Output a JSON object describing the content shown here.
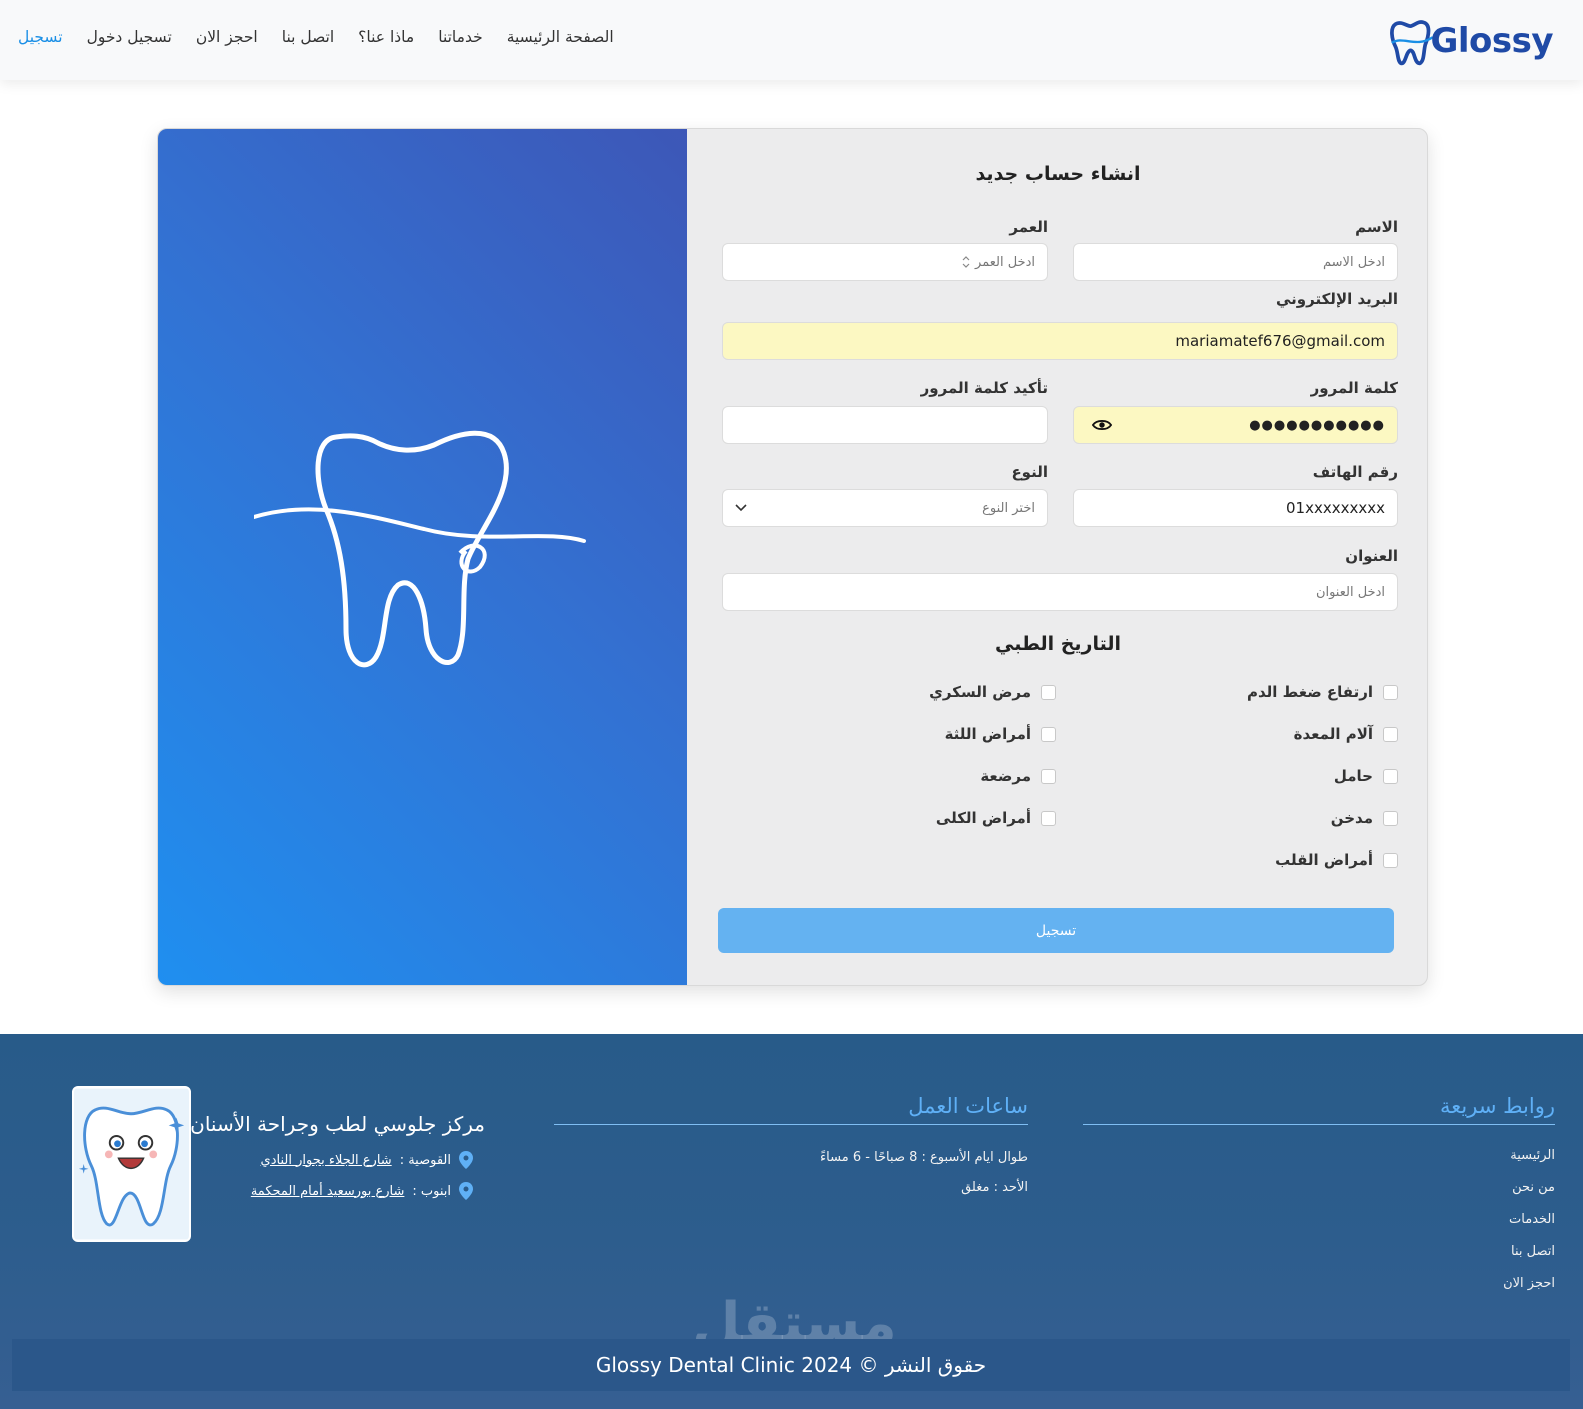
{
  "nav": {
    "logo_text": "Glossy",
    "links": [
      "الصفحة الرئيسية",
      "خدماتنا",
      "ماذا عنا؟",
      "اتصل بنا",
      "احجز الان",
      "تسجيل دخول",
      "تسجيل"
    ],
    "active_index": 6
  },
  "form": {
    "title": "انشاء حساب جديد",
    "name_label": "الاسم",
    "name_placeholder": "ادخل الاسم",
    "age_label": "العمر",
    "age_placeholder": "ادخل العمر",
    "email_label": "البريد الإلكتروني",
    "email_value": "mariamatef676@gmail.com",
    "password_label": "كلمة المرور",
    "password_value": "●●●●●●●●●●●",
    "confirm_label": "تأكيد كلمة المرور",
    "confirm_value": "",
    "phone_label": "رقم الهاتف",
    "phone_value": "01xxxxxxxxx",
    "gender_label": "النوع",
    "gender_selected": "اختر النوع",
    "address_label": "العنوان",
    "address_placeholder": "ادخل العنوان",
    "medical_title": "التاريخ الطبي",
    "conditions_right": [
      "ارتفاع ضغط الدم",
      "آلام المعدة",
      "حامل",
      "مدخن",
      "أمراض القلب"
    ],
    "conditions_left": [
      "مرض السكري",
      "أمراض اللثة",
      "مرضعة",
      "أمراض الكلى"
    ],
    "submit_label": "تسجيل"
  },
  "footer": {
    "quick_links_title": "روابط سريعة",
    "quick_links": [
      "الرئيسية",
      "من نحن",
      "الخدمات",
      "اتصل بنا",
      "احجز الان"
    ],
    "hours_title": "ساعات العمل",
    "hours_lines": [
      "طوال ايام الأسبوع : 8 صباحًا - 6 مساءً",
      "الأحد : مغلق"
    ],
    "clinic_name": "مركز جلوسي لطب وجراحة الأسنان",
    "address_1_prefix": "القوصية :",
    "address_1_link": "شارع الجلاء بجوار النادي",
    "address_2_prefix": "ابنوب :",
    "address_2_link": "شارع بورسعيد أمام المحكمة",
    "copyright": "حقوق النشر © Glossy Dental Clinic 2024",
    "watermark": "مستقل"
  },
  "colors": {
    "accent": "#1a8fe6",
    "nav_bg": "#f8f9fa",
    "submit_bg": "#64b2f1",
    "footer_bg": "#2a5b8a",
    "footer_heading": "#5fb0f6",
    "autofill_bg": "#fcf8c2"
  },
  "icons": [
    "tooth-logo-icon",
    "tooth-outline-icon",
    "eye-icon",
    "chevron-down-icon",
    "spinner-arrows-icon",
    "location-pin-icon",
    "tooth-mascot-icon"
  ]
}
